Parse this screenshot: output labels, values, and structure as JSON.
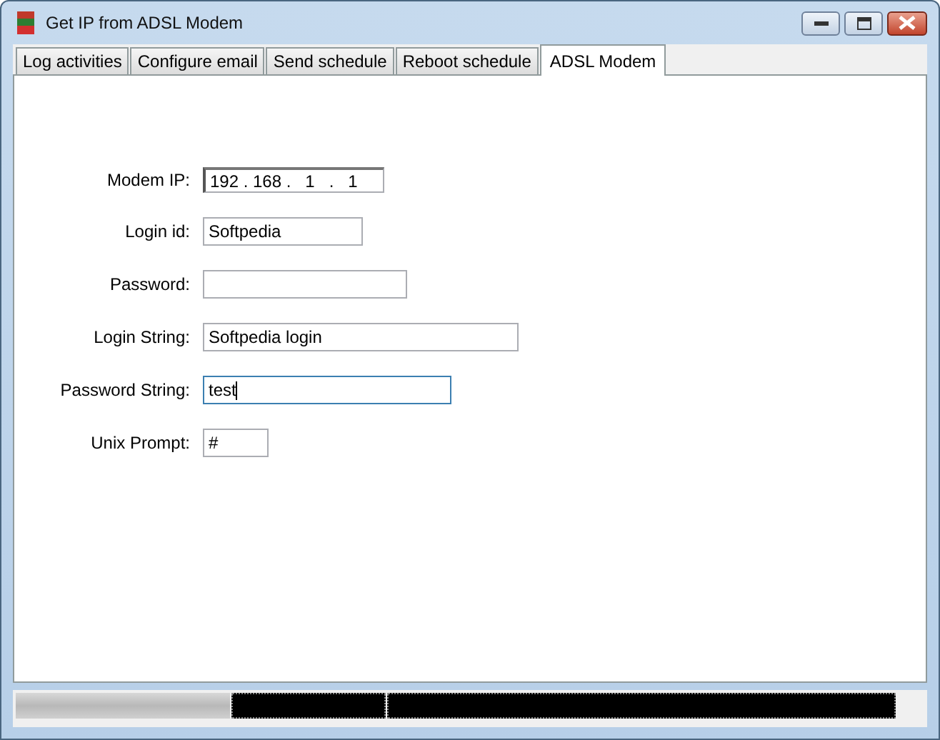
{
  "window": {
    "title": "Get IP from ADSL Modem"
  },
  "tabs": [
    {
      "label": "Log activities",
      "selected": false
    },
    {
      "label": "Configure email",
      "selected": false
    },
    {
      "label": "Send schedule",
      "selected": false
    },
    {
      "label": "Reboot schedule",
      "selected": false
    },
    {
      "label": "ADSL Modem",
      "selected": true
    }
  ],
  "fields": [
    {
      "kind": "ip",
      "label": "Modem IP:",
      "octets": [
        "192",
        "168",
        "1",
        "1"
      ],
      "separator": ".",
      "focused": false
    },
    {
      "kind": "text",
      "label": "Login id:",
      "value": "Softpedia",
      "focused": false
    },
    {
      "kind": "text",
      "label": "Password:",
      "focused": false
    },
    {
      "kind": "text",
      "label": "Login String:",
      "value": "Softpedia login",
      "focused": false
    },
    {
      "kind": "text",
      "label": "Password String:",
      "value": "test",
      "focused": true
    },
    {
      "kind": "text",
      "label": "Unix Prompt:",
      "value": "#",
      "focused": false
    }
  ],
  "status_bar": {
    "progress": {
      "level": 1
    }
  }
}
